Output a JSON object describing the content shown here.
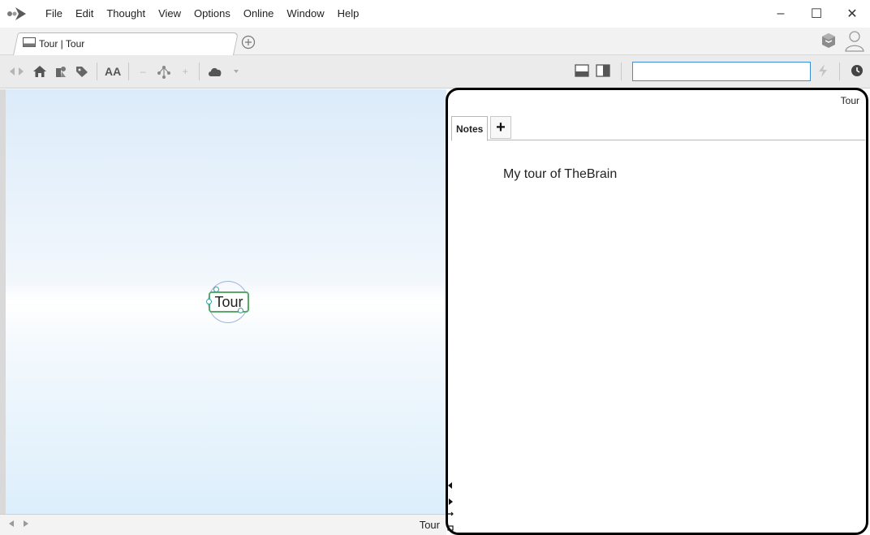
{
  "menubar": {
    "items": [
      "File",
      "Edit",
      "Thought",
      "View",
      "Options",
      "Online",
      "Window",
      "Help"
    ],
    "window_controls": {
      "minimize": "–",
      "maximize": "☐",
      "close": "✕"
    }
  },
  "tabstrip": {
    "brain_tab_label": "Tour | Tour",
    "add_tab_glyph": "⊕"
  },
  "toolbar": {
    "aa_label": "AA",
    "search_value": "",
    "icons": [
      "back-forward-icon",
      "home-icon",
      "pins-icon",
      "tag-icon",
      "font-size-icon",
      "layout-icon",
      "cloud-icon",
      "bottom-panel-icon",
      "side-panel-icon",
      "lightning-icon",
      "clock-icon"
    ]
  },
  "plex": {
    "thought_label": "Tour"
  },
  "statusbar": {
    "thought_label": "Tour"
  },
  "notes": {
    "header_title": "Tour",
    "tab_label": "Notes",
    "add_tab_glyph": "+",
    "content": "My tour of TheBrain"
  },
  "colors": {
    "accent": "#3b8fd8",
    "thought_border": "#5aa968",
    "plex_top": "#dcebfa",
    "plex_middle": "#ffffff"
  }
}
